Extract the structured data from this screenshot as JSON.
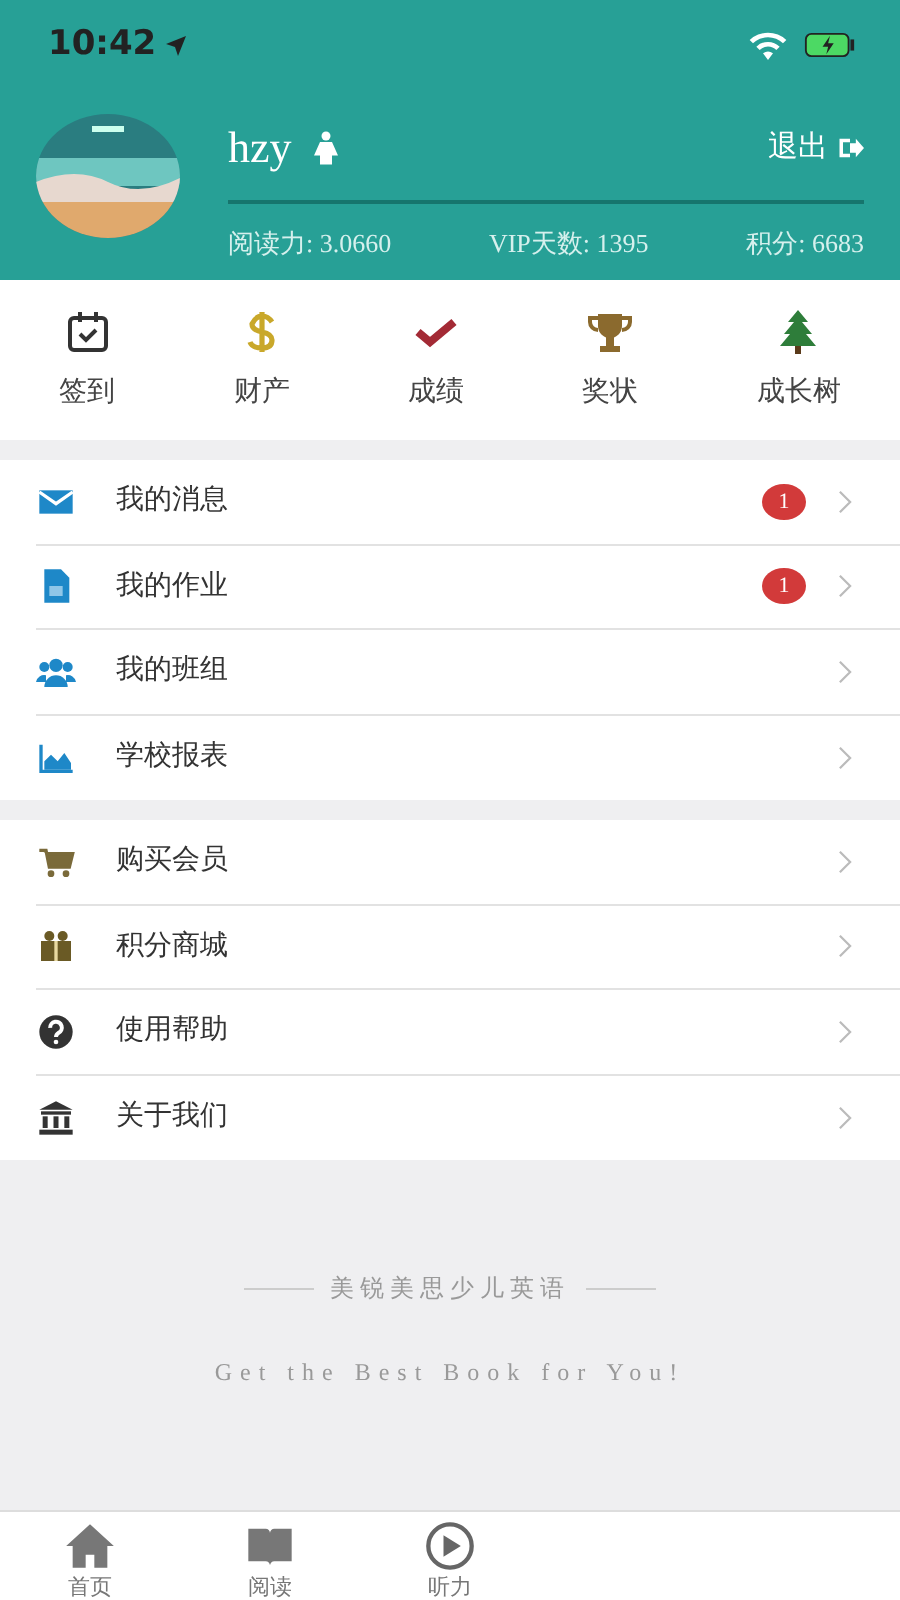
{
  "status_bar": {
    "time": "10:42"
  },
  "profile": {
    "name": "hzy",
    "logout": "退出",
    "stats": [
      "阅读力: 3.0660",
      "VIP天数: 1395",
      "积分: 6683"
    ]
  },
  "shortcuts": [
    {
      "label": "签到"
    },
    {
      "label": "财产"
    },
    {
      "label": "成绩"
    },
    {
      "label": "奖状"
    },
    {
      "label": "成长树"
    }
  ],
  "menu_groups": [
    [
      {
        "label": "我的消息",
        "badge": "1"
      },
      {
        "label": "我的作业",
        "badge": "1"
      },
      {
        "label": "我的班组"
      },
      {
        "label": "学校报表"
      }
    ],
    [
      {
        "label": "购买会员"
      },
      {
        "label": "积分商城"
      },
      {
        "label": "使用帮助"
      },
      {
        "label": "关于我们"
      }
    ]
  ],
  "footer": {
    "title": "美锐美思少儿英语",
    "slogan": "Get the Best Book for You!"
  },
  "tab_bar": [
    {
      "label": "首页"
    },
    {
      "label": "阅读"
    },
    {
      "label": "听力"
    }
  ]
}
